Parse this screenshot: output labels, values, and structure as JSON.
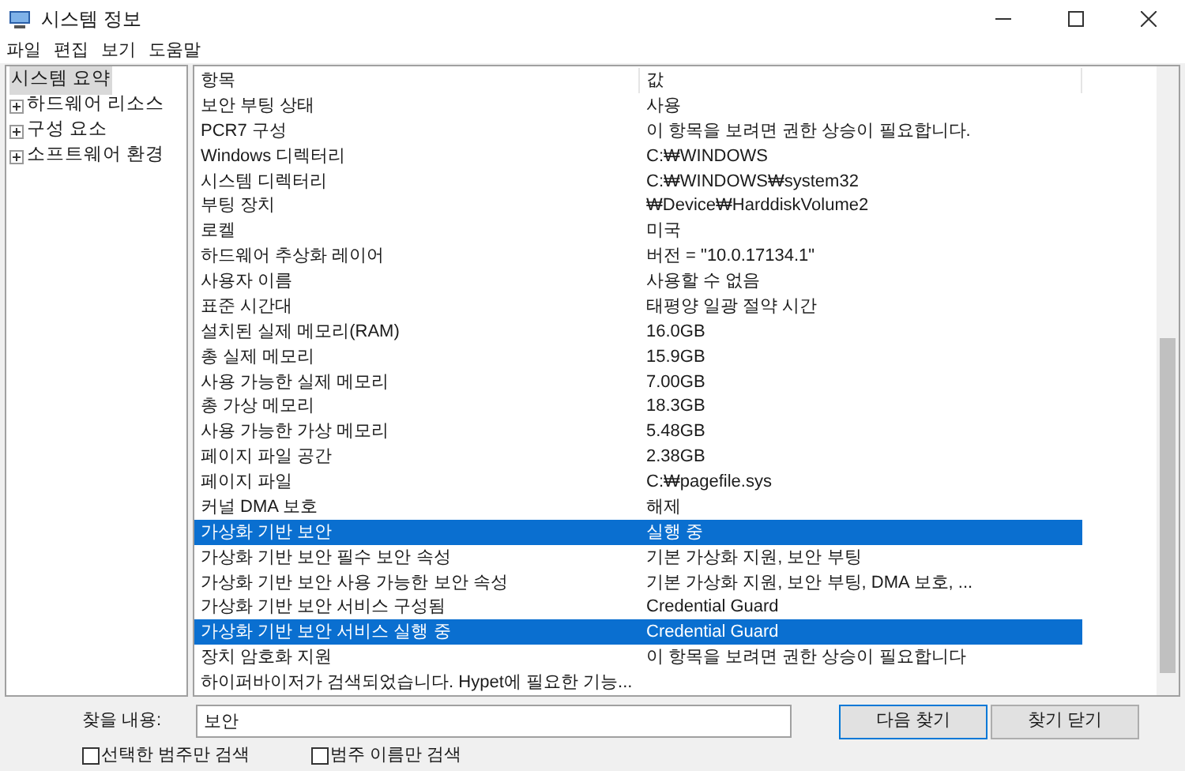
{
  "window": {
    "title": "시스템 정보"
  },
  "menu": [
    "파일",
    "편집",
    "보기",
    "도움말"
  ],
  "tree": [
    {
      "label": "시스템 요약",
      "selected": true,
      "expandable": false
    },
    {
      "label": "하드웨어 리소스",
      "selected": false,
      "expandable": true
    },
    {
      "label": "구성 요소",
      "selected": false,
      "expandable": true
    },
    {
      "label": "소프트웨어 환경",
      "selected": false,
      "expandable": true
    }
  ],
  "table": {
    "columns": [
      "항목",
      "값"
    ],
    "rows": [
      {
        "item": "보안 부팅 상태",
        "value": "사용",
        "selected": false
      },
      {
        "item": "PCR7 구성",
        "value": "이 항목을 보려면 권한 상승이 필요합니다.",
        "selected": false
      },
      {
        "item": "Windows 디렉터리",
        "value": "C:₩WINDOWS",
        "selected": false
      },
      {
        "item": "시스템 디렉터리",
        "value": "C:₩WINDOWS₩system32",
        "selected": false
      },
      {
        "item": "부팅 장치",
        "value": "₩Device₩HarddiskVolume2",
        "selected": false
      },
      {
        "item": "로켈",
        "value": "미국",
        "selected": false
      },
      {
        "item": "하드웨어 추상화 레이어",
        "value": "버전 = \"10.0.17134.1\"",
        "selected": false
      },
      {
        "item": "사용자 이름",
        "value": "사용할 수 없음",
        "selected": false
      },
      {
        "item": "표준 시간대",
        "value": "태평양 일광 절약 시간",
        "selected": false
      },
      {
        "item": "설치된 실제 메모리(RAM)",
        "value": "16.0GB",
        "selected": false
      },
      {
        "item": "총 실제 메모리",
        "value": "15.9GB",
        "selected": false
      },
      {
        "item": "사용 가능한 실제 메모리",
        "value": "7.00GB",
        "selected": false
      },
      {
        "item": "총 가상 메모리",
        "value": "18.3GB",
        "selected": false
      },
      {
        "item": "사용 가능한 가상 메모리",
        "value": "5.48GB",
        "selected": false
      },
      {
        "item": "페이지 파일 공간",
        "value": "2.38GB",
        "selected": false
      },
      {
        "item": "페이지 파일",
        "value": "C:₩pagefile.sys",
        "selected": false
      },
      {
        "item": "커널 DMA 보호",
        "value": "해제",
        "selected": false
      },
      {
        "item": "가상화 기반 보안",
        "value": "실행 중",
        "selected": true
      },
      {
        "item": "가상화 기반 보안 필수 보안 속성",
        "value": "기본 가상화 지원, 보안 부팅",
        "selected": false
      },
      {
        "item": "가상화 기반 보안 사용 가능한 보안 속성",
        "value": "기본 가상화 지원, 보안 부팅, DMA 보호, ...",
        "selected": false
      },
      {
        "item": "가상화 기반 보안 서비스 구성됨",
        "value": "Credential Guard",
        "selected": false
      },
      {
        "item": "가상화 기반 보안 서비스 실행 중",
        "value": "Credential Guard",
        "selected": true
      },
      {
        "item": "장치 암호화 지원",
        "value": "이 항목을 보려면 권한 상승이 필요합니다",
        "selected": false
      },
      {
        "item": "하이퍼바이저가 검색되었습니다. Hypet에 필요한 기능...",
        "selected": false
      }
    ]
  },
  "find": {
    "label": "찾을 내용:",
    "value": "보안",
    "buttons": [
      "다음 찾기",
      "찾기 닫기"
    ],
    "options": [
      {
        "label": "선택한 범주만 검색",
        "checked": false
      },
      {
        "label": "범주 이름만 검색",
        "checked": false
      }
    ]
  }
}
